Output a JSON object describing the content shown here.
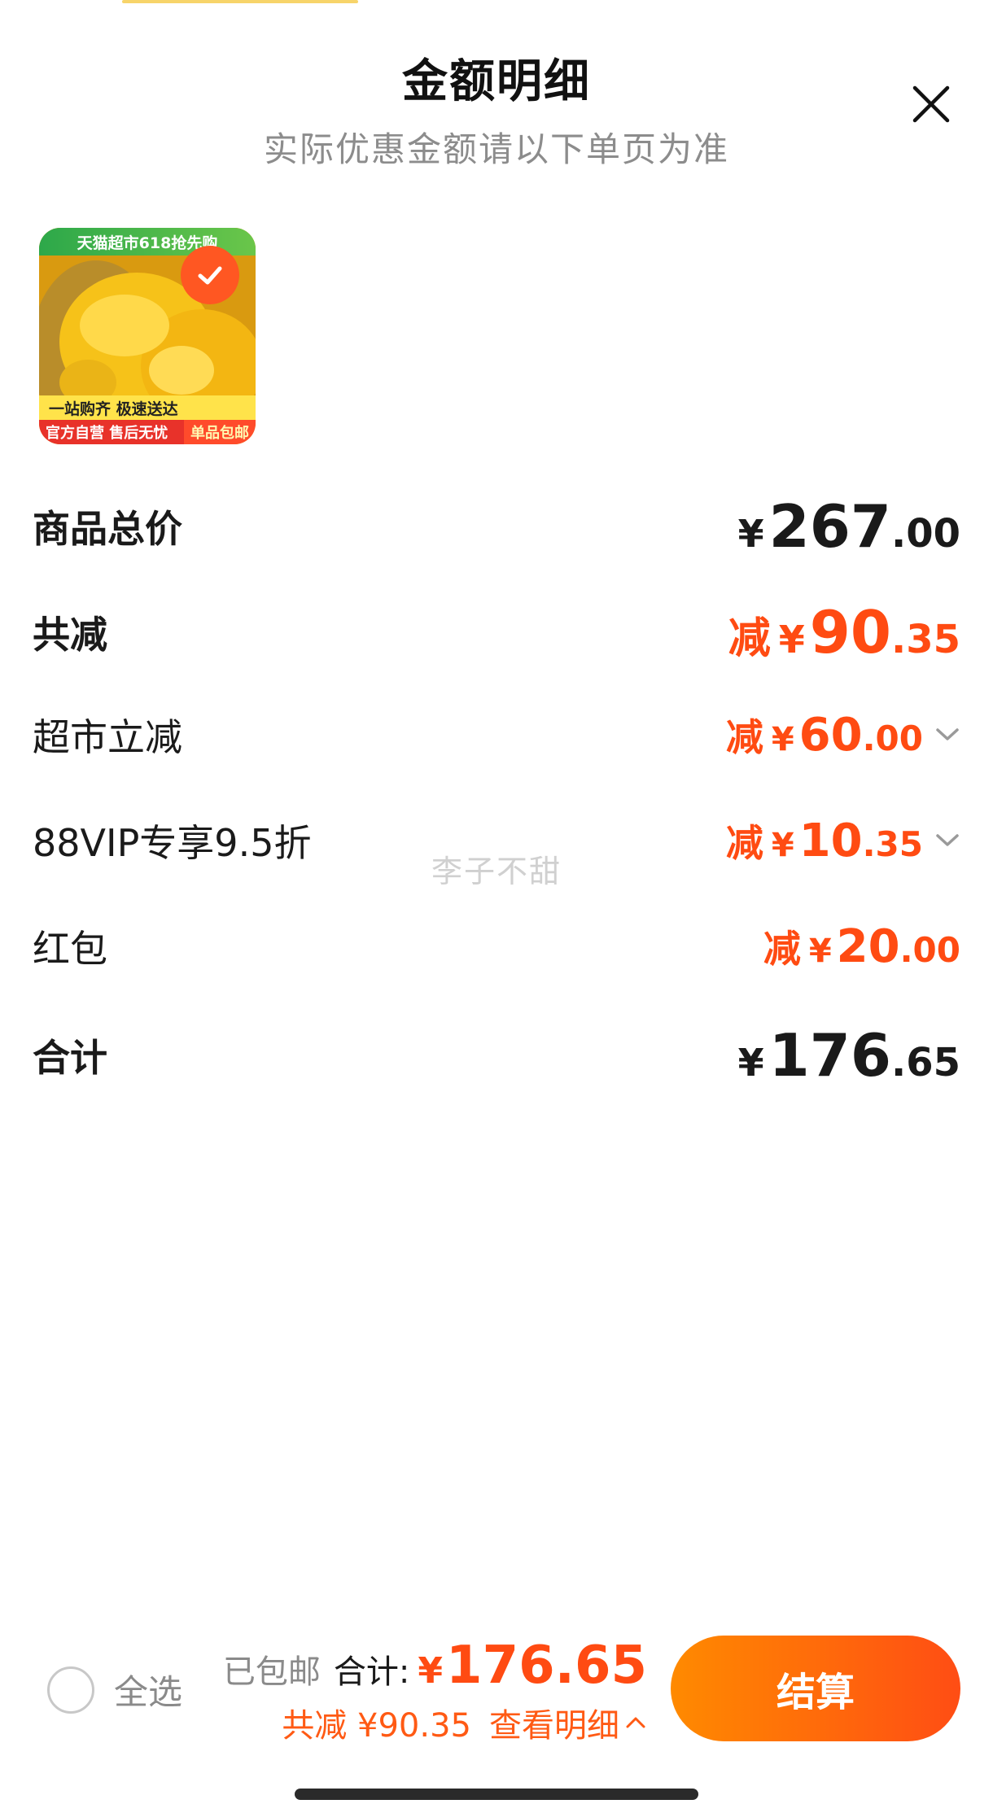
{
  "header": {
    "title": "金额明细",
    "subtitle": "实际优惠金额请以下单页为准"
  },
  "product": {
    "banner_text": "天猫超市618抢先购",
    "slogan": "一站购齐 极速送达",
    "footer_left": "官方自营 售后无忧",
    "footer_right": "单品包邮",
    "selected": true
  },
  "rows": {
    "subtotal": {
      "label": "商品总价",
      "currency": "¥",
      "int": "267",
      "dec": ".00"
    },
    "total_discount": {
      "label": "共减",
      "prefix": "减",
      "currency": "¥",
      "int": "90",
      "dec": ".35"
    },
    "market_discount": {
      "label": "超市立减",
      "prefix": "减",
      "currency": "¥",
      "int": "60",
      "dec": ".00"
    },
    "vip_discount": {
      "label": "88VIP专享9.5折",
      "prefix": "减",
      "currency": "¥",
      "int": "10",
      "dec": ".35"
    },
    "red_packet": {
      "label": "红包",
      "prefix": "减",
      "currency": "¥",
      "int": "20",
      "dec": ".00"
    },
    "total": {
      "label": "合计",
      "currency": "¥",
      "int": "176",
      "dec": ".65"
    }
  },
  "watermark": "李子不甜",
  "bottom_bar": {
    "select_all_label": "全选",
    "shipping": "已包邮",
    "total_label": "合计:",
    "total_currency": "¥",
    "total_value": "176.65",
    "discount_summary": "共减 ¥90.35",
    "view_detail": "查看明细",
    "checkout_label": "结算"
  },
  "colors": {
    "accent_orange": "#ff4b12",
    "checkout_gradient_start": "#ff8a00",
    "checkout_gradient_end": "#ff4d14"
  }
}
